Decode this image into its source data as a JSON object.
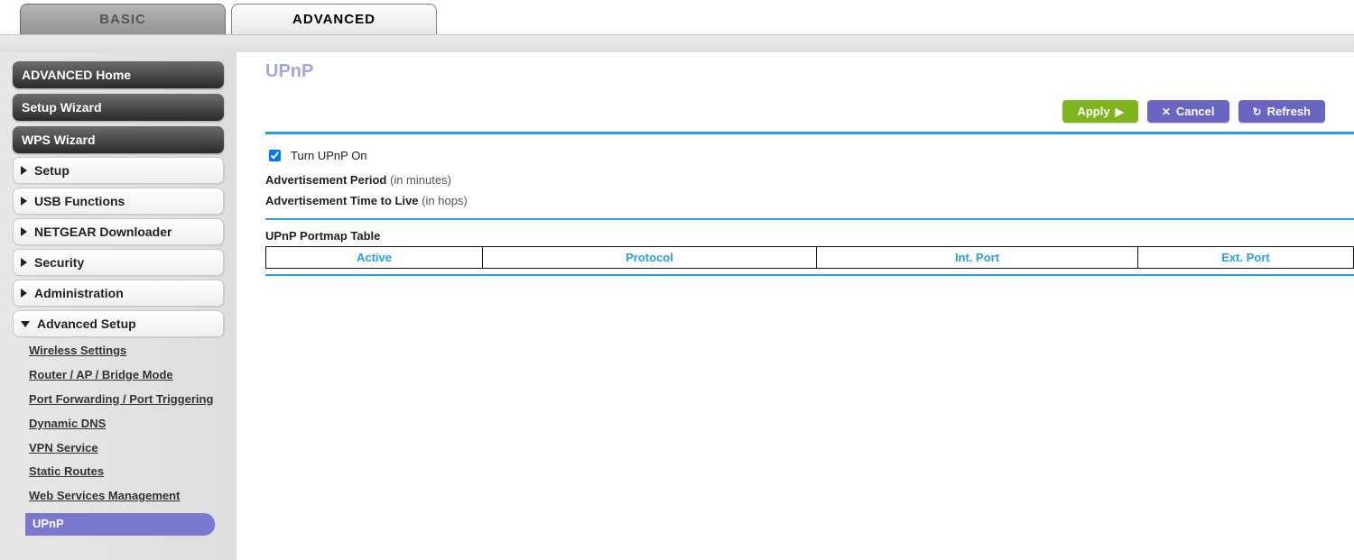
{
  "tabs": {
    "basic": "BASIC",
    "advanced": "ADVANCED"
  },
  "sidebar": {
    "home": "ADVANCED Home",
    "setup_wizard": "Setup Wizard",
    "wps_wizard": "WPS Wizard",
    "cats": {
      "setup": "Setup",
      "usb": "USB Functions",
      "downloader": "NETGEAR Downloader",
      "security": "Security",
      "administration": "Administration",
      "advanced_setup": "Advanced Setup"
    },
    "adv_sub": {
      "wireless": "Wireless Settings",
      "router_mode": "Router / AP / Bridge Mode",
      "port_fwd": "Port Forwarding / Port Triggering",
      "ddns": "Dynamic DNS",
      "vpn": "VPN Service",
      "static_routes": "Static Routes",
      "web_services": "Web Services Management",
      "upnp": "UPnP"
    }
  },
  "page": {
    "title": "UPnP",
    "buttons": {
      "apply": "Apply",
      "cancel": "Cancel",
      "refresh": "Refresh"
    },
    "turn_on_label": "Turn UPnP On",
    "turn_on_checked": true,
    "ad_period_label": "Advertisement Period",
    "ad_period_hint": "(in minutes)",
    "ad_ttl_label": "Advertisement Time to Live",
    "ad_ttl_hint": "(in hops)",
    "table_title": "UPnP Portmap Table",
    "columns": {
      "active": "Active",
      "protocol": "Protocol",
      "int_port": "Int. Port",
      "ext_port": "Ext. Port"
    }
  }
}
